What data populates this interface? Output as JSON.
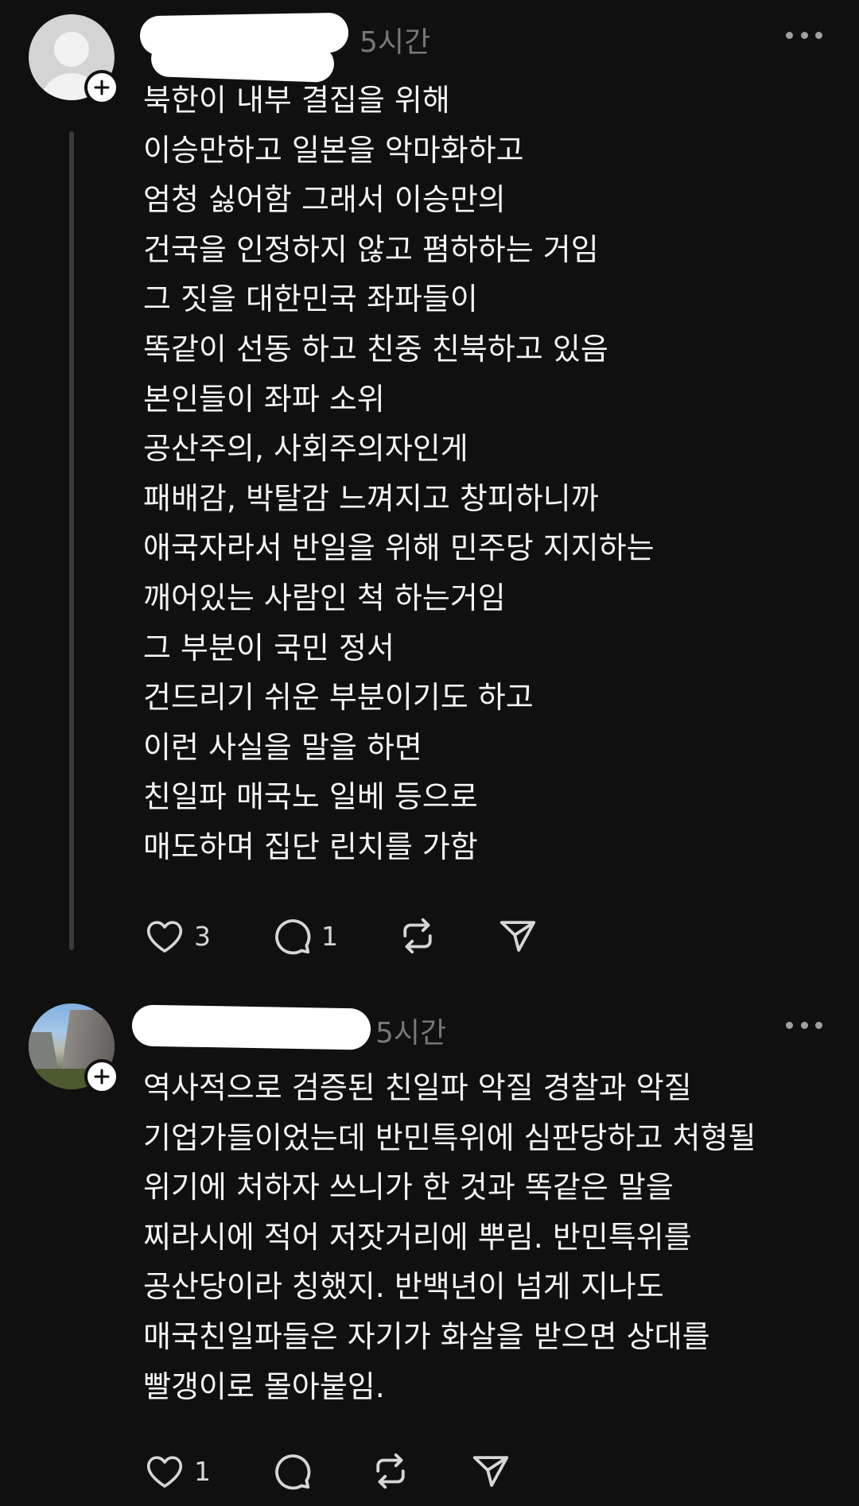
{
  "posts": [
    {
      "time": "5시간",
      "lines": [
        "북한이 내부 결집을 위해",
        "이승만하고 일본을 악마화하고",
        "엄청 싫어함 그래서 이승만의",
        "건국을 인정하지 않고 폄하하는 거임",
        "그 짓을 대한민국 좌파들이",
        "똑같이 선동 하고 친중 친북하고 있음",
        "본인들이 좌파 소위",
        "공산주의, 사회주의자인게",
        "패배감, 박탈감 느껴지고 창피하니까",
        "애국자라서 반일을 위해 민주당 지지하는",
        "깨어있는 사람인 척 하는거임",
        "그 부분이 국민 정서",
        "건드리기 쉬운 부분이기도 하고",
        "이런 사실을 말을 하면",
        "친일파 매국노 일베 등으로",
        "매도하며 집단 린치를 가함"
      ],
      "likes": "3",
      "replies": "1"
    },
    {
      "time": "5시간",
      "lines": [
        "역사적으로 검증된 친일파 악질 경찰과 악질",
        "기업가들이었는데 반민특위에 심판당하고 처형될",
        "위기에 처하자 쓰니가 한 것과 똑같은 말을",
        "찌라시에 적어 저잣거리에 뿌림. 반민특위를",
        "공산당이라 칭했지. 반백년이 넘게 지나도",
        "매국친일파들은 자기가 화살을 받으면 상대를",
        "빨갱이로 몰아붙임."
      ],
      "likes": "1"
    }
  ],
  "icons": {
    "like": "heart-icon",
    "reply": "comment-icon",
    "repost": "repost-icon",
    "share": "send-icon",
    "more": "more-dots-icon",
    "follow": "plus-icon"
  },
  "colors": {
    "background": "#101010",
    "text": "#f3f5f7",
    "muted": "#777777",
    "icon": "#d6d6d6"
  }
}
